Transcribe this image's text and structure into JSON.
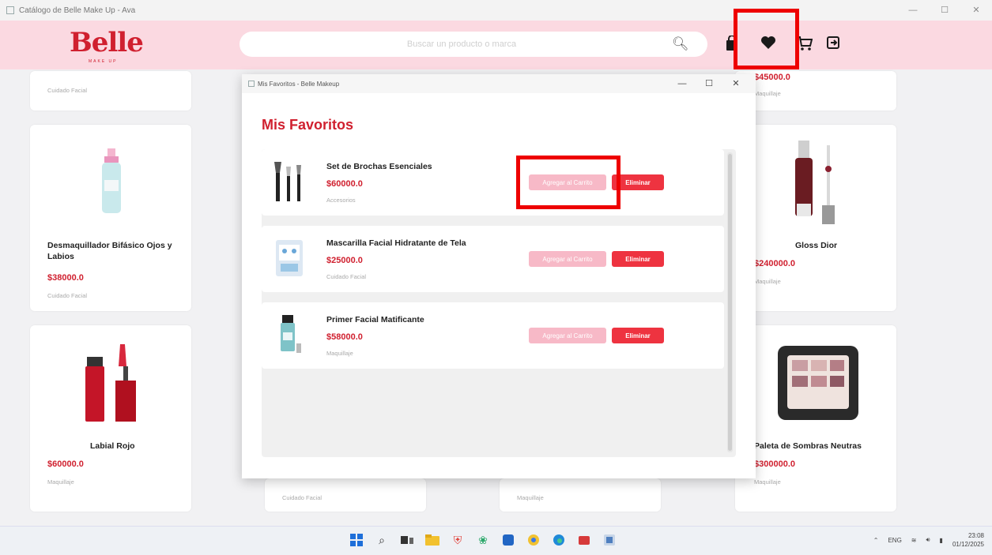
{
  "window": {
    "title": "Catálogo de Belle Make Up - Ava",
    "controls": [
      "—",
      "☐",
      "✕"
    ]
  },
  "header": {
    "logo": "Belle",
    "logo_sub": "MAKE UP",
    "search_placeholder": "Buscar un producto o marca",
    "icons": [
      "bag-icon",
      "heart-icon",
      "cart-icon",
      "logout-icon"
    ]
  },
  "cards": {
    "c1": {
      "category": "Cuidado Facial"
    },
    "c2": {
      "name": "Desmaquillador Bifásico Ojos y Labios",
      "price": "$38000.0",
      "category": "Cuidado Facial"
    },
    "c3": {
      "name": "Labial Rojo",
      "price": "$60000.0",
      "category": "Maquillaje"
    },
    "c4": {
      "price": "$45000.0",
      "category": "Maquillaje"
    },
    "c5": {
      "name": "Gloss Dior",
      "price": "$240000.0",
      "category": "Maquillaje"
    },
    "c6": {
      "name": "Paleta de Sombras Neutras",
      "price": "$300000.0",
      "category": "Maquillaje"
    },
    "c7": {
      "category": "Cuidado Facial"
    },
    "c8": {
      "category": "Maquillaje"
    }
  },
  "dialog": {
    "title": "Mis Favoritos - Belle Makeup",
    "heading": "Mis Favoritos",
    "items": [
      {
        "name": "Set de Brochas Esenciales",
        "price": "$60000.0",
        "category": "Accesorios",
        "add_label": "Agregar al Carrito",
        "delete_label": "Eliminar"
      },
      {
        "name": "Mascarilla Facial Hidratante de Tela",
        "price": "$25000.0",
        "category": "Cuidado Facial",
        "add_label": "Agregar al Carrito",
        "delete_label": "Eliminar"
      },
      {
        "name": "Primer Facial Matificante",
        "price": "$58000.0",
        "category": "Maquillaje",
        "add_label": "Agregar al Carrito",
        "delete_label": "Eliminar"
      }
    ]
  },
  "taskbar": {
    "lang": "ENG",
    "time": "23:08",
    "date": "01/12/2025"
  },
  "colors": {
    "brand": "#d0202f",
    "header_bg": "#fbd9e1",
    "cart_btn": "#f7b9c7",
    "delete_btn": "#ee3340",
    "highlight": "#ee0000"
  }
}
